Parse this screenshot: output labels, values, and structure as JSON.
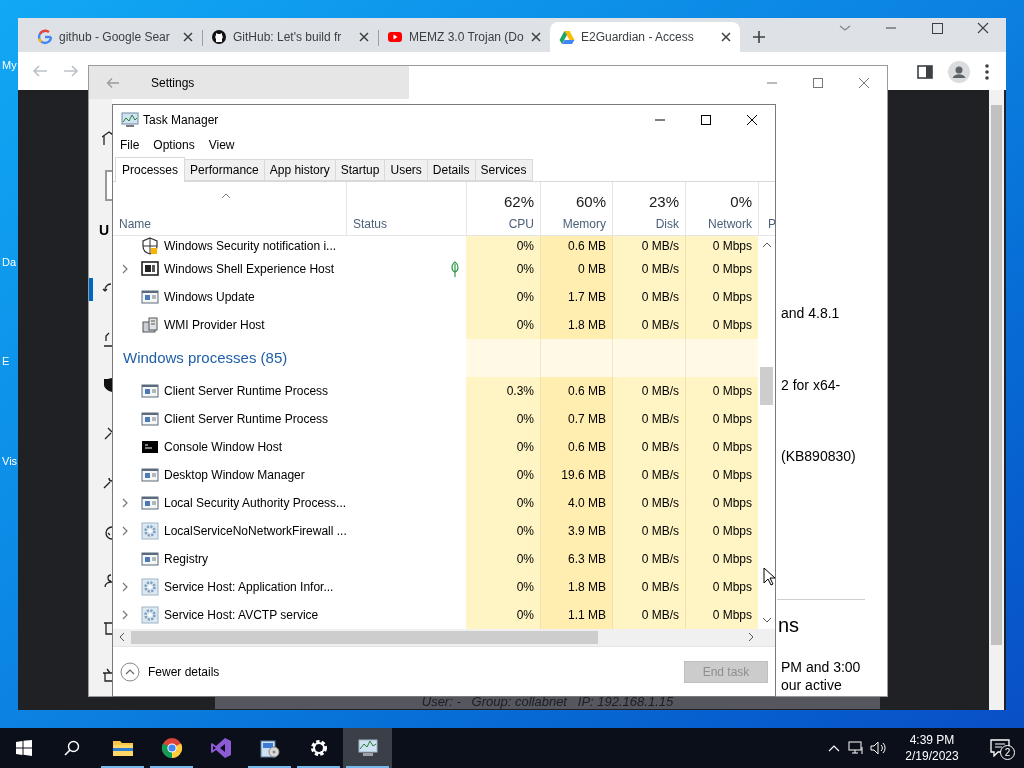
{
  "desktop": {
    "icon_labels": [
      "My",
      "Da",
      "E",
      "Vis"
    ]
  },
  "browser": {
    "tabs": [
      {
        "label": "github - Google Sear",
        "kind": "search",
        "selected": false
      },
      {
        "label": "GitHub: Let's build fr",
        "kind": "repo",
        "selected": false
      },
      {
        "label": "MEMZ 3.0 Trojan (Do",
        "kind": "video",
        "selected": false
      },
      {
        "label": "E2Guardian - Access",
        "kind": "drive",
        "selected": true
      }
    ],
    "page_footer": "User: -   Group: collabnet   IP: 192.168.1.15"
  },
  "settings": {
    "title": "Settings",
    "nav_heading": "U",
    "content_lines": [
      "and 4.8.1",
      "2 for x64-",
      "(KB890830)"
    ],
    "section_heading": "ns",
    "paragraph_lines": [
      "PM and 3:00",
      "our active"
    ]
  },
  "task_manager": {
    "title": "Task Manager",
    "menu": [
      "File",
      "Options",
      "View"
    ],
    "tabs": [
      {
        "label": "Processes",
        "selected": true
      },
      {
        "label": "Performance",
        "selected": false
      },
      {
        "label": "App history",
        "selected": false
      },
      {
        "label": "Startup",
        "selected": false
      },
      {
        "label": "Users",
        "selected": false
      },
      {
        "label": "Details",
        "selected": false
      },
      {
        "label": "Services",
        "selected": false
      }
    ],
    "columns": [
      {
        "label": "Name"
      },
      {
        "label": "Status"
      },
      {
        "percent": "62%",
        "label": "CPU"
      },
      {
        "percent": "60%",
        "label": "Memory"
      },
      {
        "percent": "23%",
        "label": "Disk"
      },
      {
        "percent": "0%",
        "label": "Network"
      },
      {
        "label": "P"
      }
    ],
    "rows": [
      {
        "kind": "shield",
        "name": "Windows Security notification i...",
        "expandable": false,
        "suspended": false,
        "cpu": "0%",
        "memory": "0.6 MB",
        "disk": "0 MB/s",
        "network": "0 Mbps"
      },
      {
        "kind": "shell",
        "name": "Windows Shell Experience Host",
        "expandable": true,
        "suspended": true,
        "cpu": "0%",
        "memory": "0 MB",
        "disk": "0 MB/s",
        "network": "0 Mbps"
      },
      {
        "kind": "window",
        "name": "Windows Update",
        "expandable": false,
        "suspended": false,
        "cpu": "0%",
        "memory": "1.7 MB",
        "disk": "0 MB/s",
        "network": "0 Mbps"
      },
      {
        "kind": "server",
        "name": "WMI Provider Host",
        "expandable": false,
        "suspended": false,
        "cpu": "0%",
        "memory": "1.8 MB",
        "disk": "0 MB/s",
        "network": "0 Mbps"
      },
      {
        "kind": "group",
        "name": "Windows processes (85)"
      },
      {
        "kind": "window",
        "name": "Client Server Runtime Process",
        "expandable": false,
        "suspended": false,
        "cpu": "0.3%",
        "memory": "0.6 MB",
        "disk": "0 MB/s",
        "network": "0 Mbps"
      },
      {
        "kind": "window",
        "name": "Client Server Runtime Process",
        "expandable": false,
        "suspended": false,
        "cpu": "0%",
        "memory": "0.7 MB",
        "disk": "0 MB/s",
        "network": "0 Mbps"
      },
      {
        "kind": "console",
        "name": "Console Window Host",
        "expandable": false,
        "suspended": false,
        "cpu": "0%",
        "memory": "0.6 MB",
        "disk": "0 MB/s",
        "network": "0 Mbps"
      },
      {
        "kind": "window",
        "name": "Desktop Window Manager",
        "expandable": false,
        "suspended": false,
        "cpu": "0%",
        "memory": "19.6 MB",
        "disk": "0 MB/s",
        "network": "0 Mbps"
      },
      {
        "kind": "window",
        "name": "Local Security Authority Process...",
        "expandable": true,
        "suspended": false,
        "cpu": "0%",
        "memory": "4.0 MB",
        "disk": "0 MB/s",
        "network": "0 Mbps"
      },
      {
        "kind": "service",
        "name": "LocalServiceNoNetworkFirewall ...",
        "expandable": true,
        "suspended": false,
        "cpu": "0%",
        "memory": "3.9 MB",
        "disk": "0 MB/s",
        "network": "0 Mbps"
      },
      {
        "kind": "window",
        "name": "Registry",
        "expandable": false,
        "suspended": false,
        "cpu": "0%",
        "memory": "6.3 MB",
        "disk": "0 MB/s",
        "network": "0 Mbps"
      },
      {
        "kind": "service",
        "name": "Service Host: Application Infor...",
        "expandable": true,
        "suspended": false,
        "cpu": "0%",
        "memory": "1.8 MB",
        "disk": "0 MB/s",
        "network": "0 Mbps"
      },
      {
        "kind": "service",
        "name": "Service Host: AVCTP service",
        "expandable": true,
        "suspended": false,
        "cpu": "0%",
        "memory": "1.1 MB",
        "disk": "0 MB/s",
        "network": "0 Mbps"
      }
    ],
    "details_toggle": "Fewer details",
    "end_task": {
      "label": "End task",
      "disabled": true
    }
  },
  "taskbar": {
    "apps": [
      {
        "kind": "folder",
        "running": true,
        "selected": false
      },
      {
        "kind": "browser",
        "running": true,
        "selected": false
      },
      {
        "kind": "ide",
        "running": false,
        "selected": false
      },
      {
        "kind": "installer",
        "running": true,
        "selected": false
      },
      {
        "kind": "gear",
        "running": true,
        "selected": false
      },
      {
        "kind": "monitor",
        "running": true,
        "selected": true
      }
    ],
    "time": "4:39 PM",
    "date": "2/19/2023",
    "notifications": "2"
  }
}
